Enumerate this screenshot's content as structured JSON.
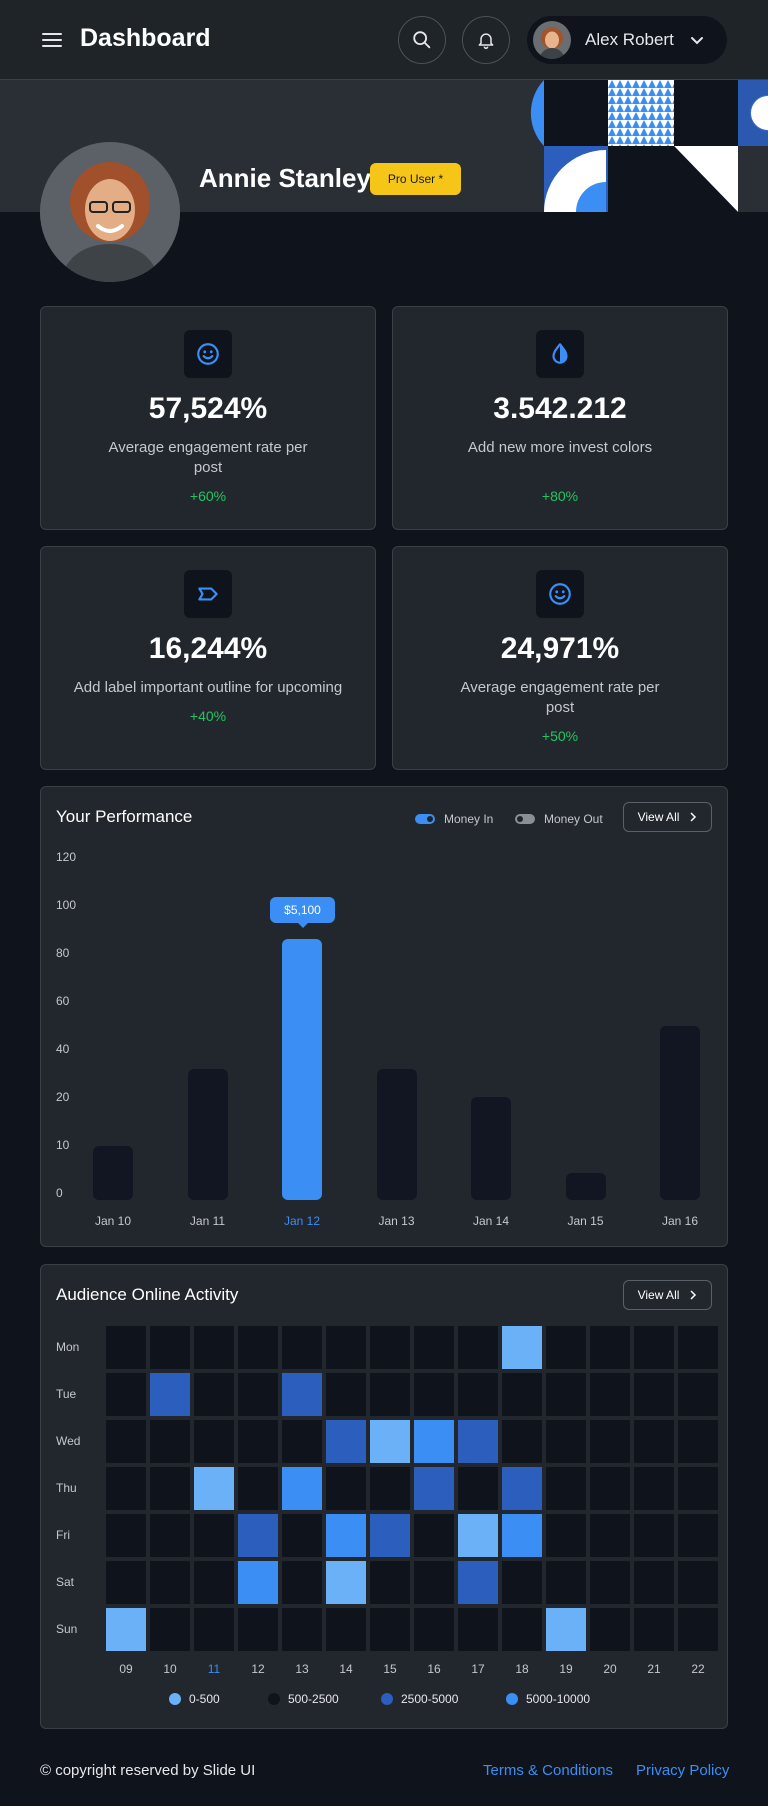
{
  "header": {
    "title": "Dashboard",
    "user_name": "Alex Robert",
    "icons": [
      "menu-icon",
      "search-icon",
      "bell-icon",
      "chevron-down-icon"
    ]
  },
  "profile": {
    "name": "Annie Stanley",
    "badge": "Pro User *"
  },
  "colors": {
    "accent": "#3b8ef3",
    "positive": "#22c55e",
    "badge": "#f5c518",
    "card_bg": "#22272d",
    "page_bg": "#0f131c"
  },
  "stats": [
    {
      "icon": "smile-icon",
      "value": "57,524%",
      "label": "Average engagement rate per post",
      "change": "+60%"
    },
    {
      "icon": "drop-icon",
      "value": "3.542.212",
      "label": "Add new more invest colors",
      "change": "+80%"
    },
    {
      "icon": "label-icon",
      "value": "16,244%",
      "label": "Add label important outline for upcoming",
      "change": "+40%"
    },
    {
      "icon": "smile-icon",
      "value": "24,971%",
      "label": "Average engagement rate per post",
      "change": "+50%"
    }
  ],
  "performance": {
    "title": "Your Performance",
    "legend_in": "Money In",
    "legend_out": "Money Out",
    "view_all": "View All",
    "tooltip": "$5,100"
  },
  "chart_data": [
    {
      "type": "bar",
      "title": "Your Performance",
      "categories": [
        "Jan 10",
        "Jan 11",
        "Jan 12",
        "Jan 13",
        "Jan 14",
        "Jan 15",
        "Jan 16"
      ],
      "values": [
        20,
        48,
        96,
        48,
        38,
        10,
        64
      ],
      "y_ticks": [
        "120",
        "100",
        "80",
        "60",
        "40",
        "20",
        "10",
        "0"
      ],
      "highlight_index": 2,
      "highlight_label": "$5,100",
      "legend": [
        "Money In",
        "Money Out"
      ],
      "legend_placement": "top-right",
      "grid": false
    },
    {
      "type": "heatmap",
      "title": "Audience Online Activity",
      "rows": [
        "Mon",
        "Tue",
        "Wed",
        "Thu",
        "Fri",
        "Sat",
        "Sun"
      ],
      "columns": [
        "09",
        "10",
        "11",
        "12",
        "13",
        "14",
        "15",
        "16",
        "17",
        "18",
        "19",
        "20",
        "21",
        "22"
      ],
      "highlight_column": "11",
      "levels": [
        "0-500",
        "500-2500",
        "2500-5000",
        "5000-10000"
      ],
      "level_colors": [
        "#6ab1f7",
        "#0f131c",
        "#2b5ebd",
        "#3b8ef3"
      ],
      "values": [
        [
          1,
          1,
          1,
          1,
          1,
          1,
          1,
          1,
          1,
          0,
          1,
          1,
          1,
          1
        ],
        [
          1,
          2,
          1,
          1,
          2,
          1,
          1,
          1,
          1,
          1,
          1,
          1,
          1,
          1
        ],
        [
          1,
          1,
          1,
          1,
          1,
          2,
          0,
          3,
          2,
          1,
          1,
          1,
          1,
          1
        ],
        [
          1,
          1,
          0,
          1,
          3,
          1,
          1,
          2,
          1,
          2,
          1,
          1,
          1,
          1
        ],
        [
          1,
          1,
          1,
          2,
          1,
          3,
          2,
          1,
          0,
          3,
          1,
          1,
          1,
          1
        ],
        [
          1,
          1,
          1,
          3,
          1,
          0,
          1,
          1,
          2,
          1,
          1,
          1,
          1,
          1
        ],
        [
          0,
          1,
          1,
          1,
          1,
          1,
          1,
          1,
          1,
          1,
          0,
          1,
          1,
          1
        ]
      ]
    }
  ],
  "activity": {
    "title": "Audience Online Activity",
    "view_all": "View All"
  },
  "footer": {
    "copyright": "© copyright reserved by Slide UI",
    "terms": "Terms & Conditions",
    "privacy": "Privacy Policy"
  }
}
